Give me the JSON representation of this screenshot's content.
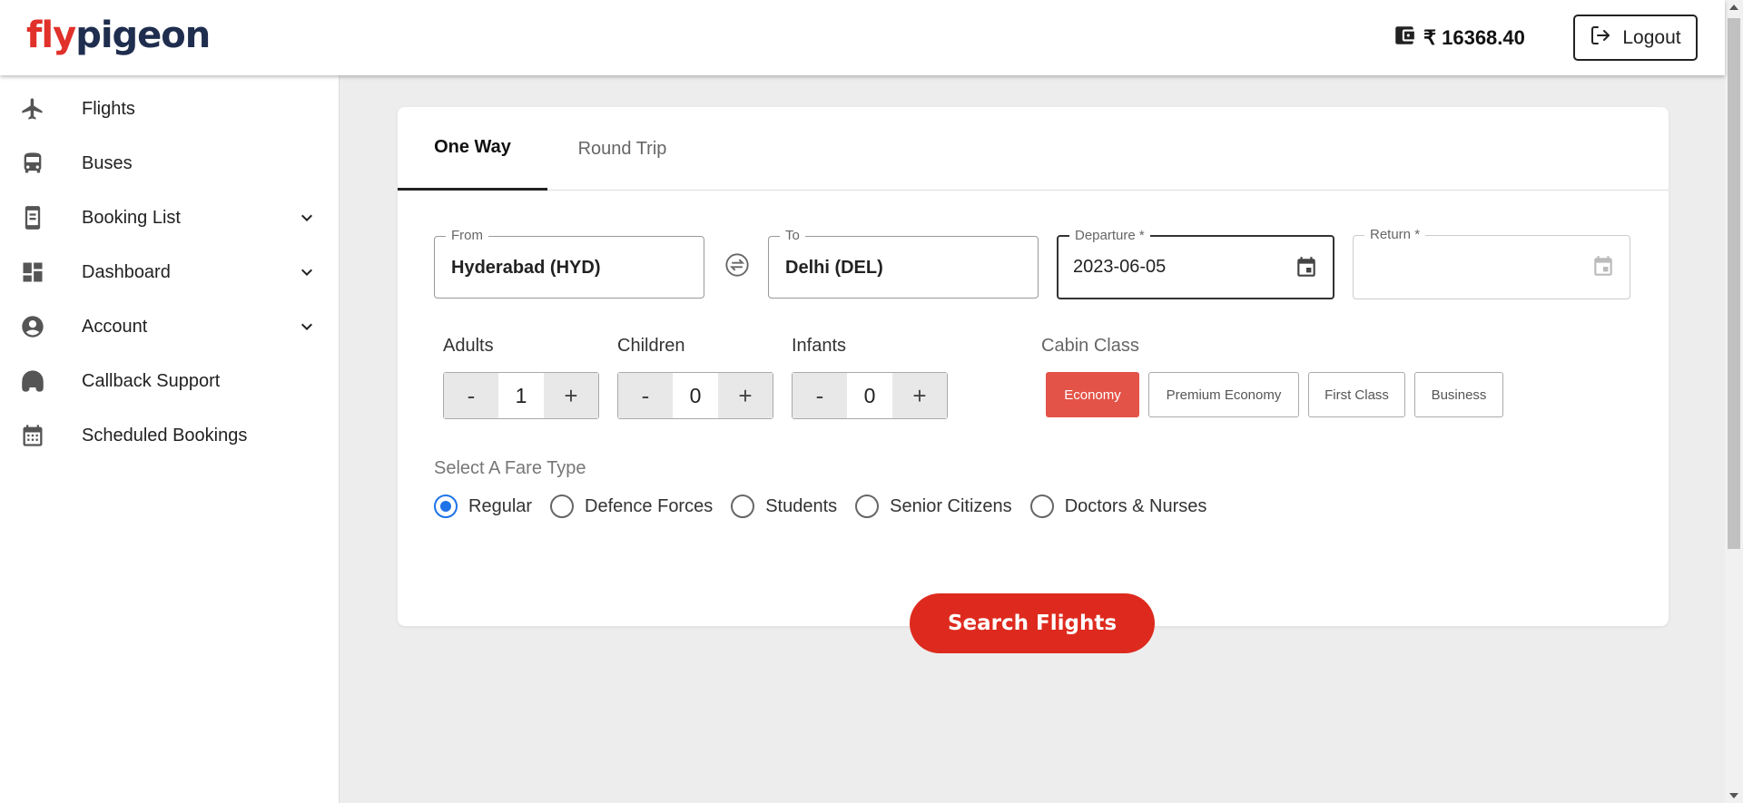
{
  "header": {
    "logo_fly": "fly",
    "logo_pigeon": "pigeon",
    "wallet_balance": "₹ 16368.40",
    "logout_label": "Logout"
  },
  "sidebar": {
    "items": [
      {
        "label": "Flights",
        "icon": "plane-icon"
      },
      {
        "label": "Buses",
        "icon": "bus-icon"
      },
      {
        "label": "Booking List",
        "icon": "booking-icon",
        "expandable": true
      },
      {
        "label": "Dashboard",
        "icon": "dashboard-icon",
        "expandable": true
      },
      {
        "label": "Account",
        "icon": "account-icon",
        "expandable": true
      },
      {
        "label": "Callback Support",
        "icon": "headset-icon"
      },
      {
        "label": "Scheduled Bookings",
        "icon": "calendar-icon"
      }
    ]
  },
  "search": {
    "tabs": [
      {
        "label": "One Way",
        "active": true
      },
      {
        "label": "Round Trip",
        "active": false
      }
    ],
    "from": {
      "label": "From",
      "value": "Hyderabad (HYD)"
    },
    "to": {
      "label": "To",
      "value": "Delhi (DEL)"
    },
    "departure": {
      "label": "Departure *",
      "value": "2023-06-05"
    },
    "return": {
      "label": "Return *",
      "value": ""
    },
    "passengers": {
      "adults": {
        "label": "Adults",
        "value": "1"
      },
      "children": {
        "label": "Children",
        "value": "0"
      },
      "infants": {
        "label": "Infants",
        "value": "0"
      },
      "minus": "-",
      "plus": "+"
    },
    "cabin": {
      "label": "Cabin Class",
      "options": [
        "Economy",
        "Premium Economy",
        "First Class",
        "Business"
      ],
      "selected": "Economy"
    },
    "fare": {
      "label": "Select A Fare Type",
      "options": [
        "Regular",
        "Defence Forces",
        "Students",
        "Senior Citizens",
        "Doctors & Nurses"
      ],
      "selected": "Regular"
    },
    "submit_label": "Search Flights"
  },
  "colors": {
    "brand_red": "#de2a1e",
    "brand_navy": "#1f2d4e",
    "cabin_active": "#e35348",
    "radio_blue": "#1e73e8"
  }
}
